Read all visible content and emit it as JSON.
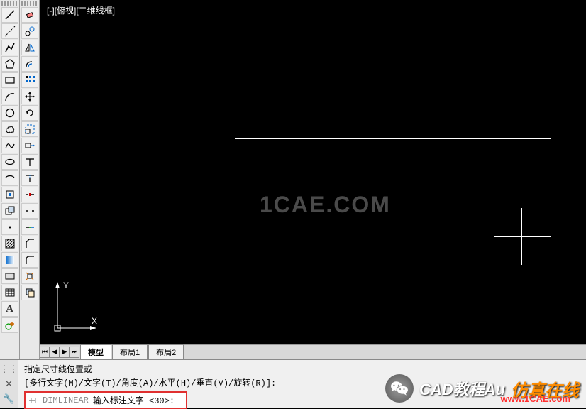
{
  "viewport": {
    "label": "[-][俯视][二维线框]"
  },
  "watermark": {
    "text": "1CAE.COM"
  },
  "tabs": {
    "model": "模型",
    "layout1": "布局1",
    "layout2": "布局2"
  },
  "command": {
    "line1": "指定尺寸线位置或",
    "line2": "[多行文字(M)/文字(T)/角度(A)/水平(H)/垂直(V)/旋转(R)]:",
    "command_name": "DIMLINEAR",
    "prompt": "输入标注文字 <30>:"
  },
  "branding": {
    "text1": "CAD教程Au",
    "text2": "仿真在线",
    "url": "www.1CAE.com"
  },
  "toolbar1": {
    "items": [
      "line",
      "construction-line",
      "polyline",
      "polygon",
      "rectangle",
      "arc",
      "circle",
      "revision-cloud",
      "spline",
      "ellipse",
      "ellipse-arc",
      "insert-block",
      "make-block",
      "point",
      "hatch",
      "gradient",
      "region",
      "table",
      "text",
      "add-selected"
    ]
  },
  "toolbar2": {
    "items": [
      "erase",
      "copy",
      "mirror",
      "offset",
      "array",
      "move",
      "rotate",
      "scale",
      "stretch",
      "trim",
      "extend",
      "break-at-point",
      "break",
      "join",
      "chamfer",
      "fillet",
      "explode",
      "draworder"
    ]
  },
  "ucs": {
    "x_label": "X",
    "y_label": "Y"
  }
}
